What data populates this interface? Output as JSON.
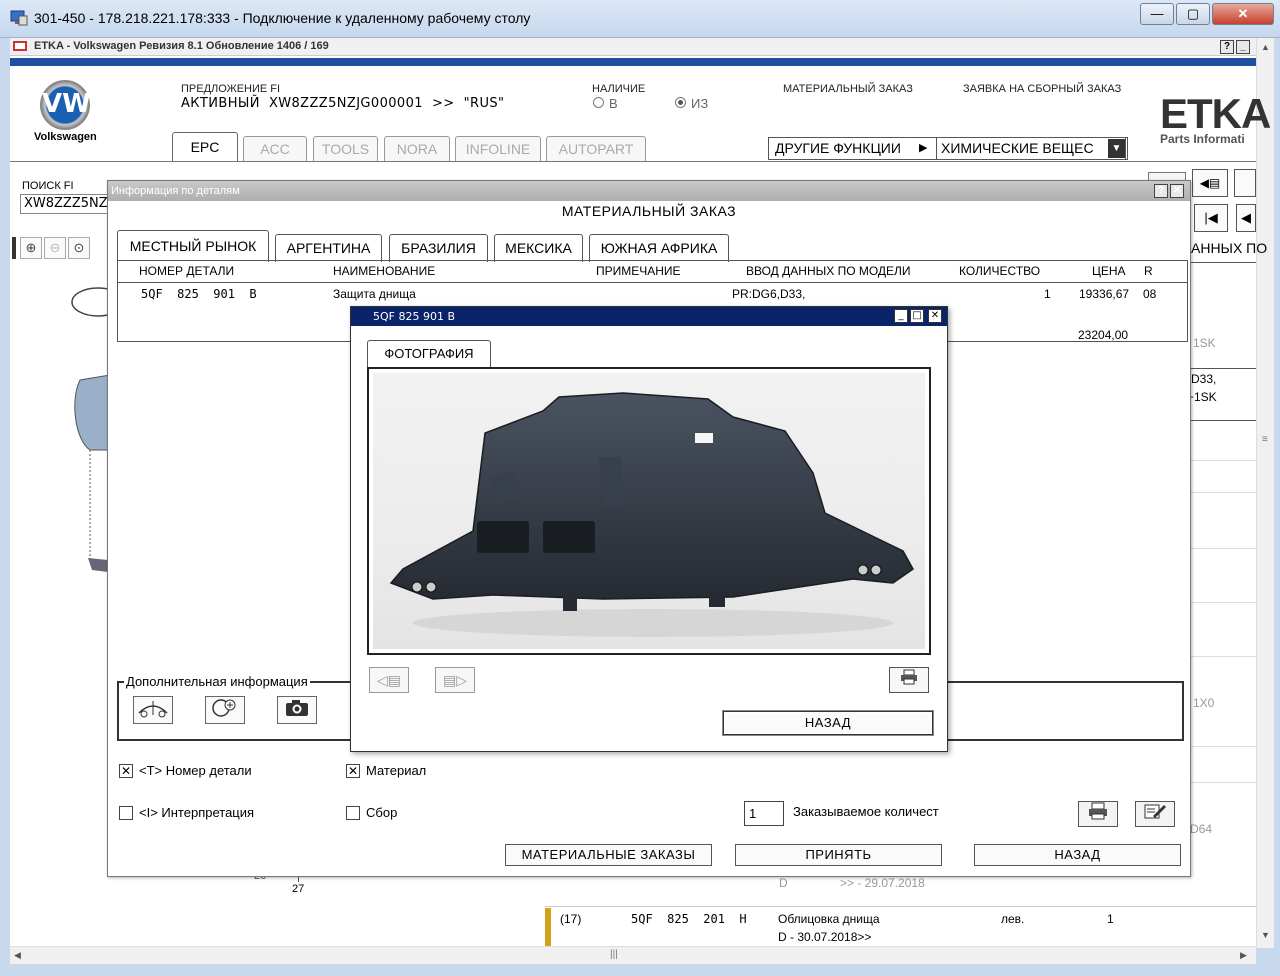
{
  "rdp": {
    "title": "301-450 - 178.218.221.178:333 - Подключение к удаленному рабочему столу",
    "min": "—",
    "max": "▢",
    "close": "✕"
  },
  "etka": {
    "title": "ETKA - Volkswagen Ревизия 8.1 Обновление 1406 / 169",
    "help": "?",
    "minimize": "_"
  },
  "header": {
    "brand": "Volkswagen",
    "vw_mark": "VW",
    "offer_label": "ПРЕДЛОЖЕНИЕ FI",
    "offer_value": "АКТИВНЫЙ  XW8ZZZ5NZJG000001  >>  \"RUS\"",
    "availability_label": "НАЛИЧИЕ",
    "avail_in": "В",
    "avail_from": "ИЗ",
    "material_order": "МАТЕРИАЛЬНЫЙ ЗАКАЗ",
    "assembly_order": "ЗАЯВКА НА СБОРНЫЙ ЗАКАЗ",
    "etka_brand": "ETKA",
    "etka_sub": "Parts Informati",
    "other_functions": "ДРУГИЕ ФУНКЦИИ",
    "chemicals": "ХИМИЧЕСКИЕ ВЕЩЕС"
  },
  "top_tabs": [
    "EPC",
    "ACC",
    "TOOLS",
    "NORA",
    "INFOLINE",
    "AUTOPART"
  ],
  "search": {
    "label": "ПОИСК FI",
    "value": "XW8ZZZ5NZ"
  },
  "background": {
    "right_header": "АННЫХ ПО",
    "right_1": "1SK",
    "right_2": "D33,",
    "right_3": "+1SK",
    "right_4": "1X0",
    "right_5": "D64",
    "row_d_label": "D",
    "row_d_date": ">> - 29.07.2018",
    "num_27": "27",
    "num_26": "26",
    "row17": {
      "pos": "(17)",
      "part": "5QF  825  201  H",
      "name": "Облицовка днища",
      "side": "лев.",
      "qty": "1",
      "sub": "D - 30.07.2018>>"
    }
  },
  "dialog": {
    "title": "Информация по деталям",
    "subtitle": "МАТЕРИАЛЬНЫЙ ЗАКАЗ",
    "help": "?",
    "close": "✕",
    "tabs": [
      "МЕСТНЫЙ РЫНОК",
      "АРГЕНТИНА",
      "БРАЗИЛИЯ",
      "МЕКСИКА",
      "ЮЖНАЯ АФРИКА"
    ],
    "columns": [
      "НОМЕР ДЕТАЛИ",
      "НАИМЕНОВАНИЕ",
      "ПРИМЕЧАНИЕ",
      "ВВОД ДАННЫХ ПО МОДЕЛИ",
      "КОЛИЧЕСТВО",
      "ЦЕНА",
      "R"
    ],
    "row": {
      "part_number": "5QF  825  901  B",
      "name": "Защита днища",
      "model_data": "PR:DG6,D33,",
      "quantity": "1",
      "price": "19336,67",
      "r": "08",
      "price2": "23204,00"
    },
    "additional_info": "Дополнительная информация",
    "chk_part_number": "<T> Номер детали",
    "chk_material": "Материал",
    "chk_interpretation": "<I> Интерпретация",
    "chk_assembly": "Сбор",
    "qty_value": "1",
    "qty_label": "Заказываемое количест",
    "btn_material_orders": "МАТЕРИАЛЬНЫЕ ЗАКАЗЫ",
    "btn_accept": "ПРИНЯТЬ",
    "btn_back": "НАЗАД"
  },
  "photo_dialog": {
    "title": "5QF 825 901 B",
    "tab": "ФОТОГРАФИЯ",
    "btn_back": "НАЗАД"
  },
  "colors": {
    "etka_blue": "#1f4fa0",
    "photo_title_bg": "#0a246a",
    "accent_yellow": "#d4a21a"
  }
}
